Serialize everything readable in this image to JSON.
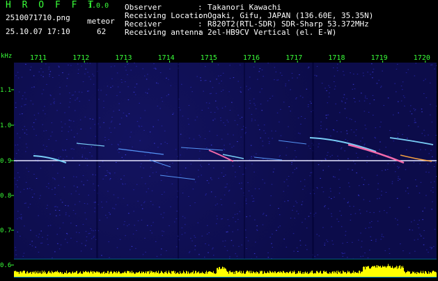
{
  "header": {
    "app_title": "H R O F F T",
    "app_version": "1.0.0",
    "file_name": "2510071710.png",
    "datetime": "25.10.07 17:10",
    "meteor_label": "meteor",
    "meteor_count": "62",
    "meta": [
      {
        "label": "Observer",
        "value": "Takanori Kawachi"
      },
      {
        "label": "Receiving Location",
        "value": "Ogaki, Gifu, JAPAN (136.60E, 35.35N)"
      },
      {
        "label": "Receiver",
        "value": "R820T2(RTL-SDR) SDR-Sharp 53.372MHz"
      },
      {
        "label": "Receiving antenna",
        "value": "2el-HB9CV Vertical (el. E-W)"
      }
    ]
  },
  "axes": {
    "y_unit": "kHz",
    "y_ticks": [
      "1.1",
      "1.0",
      "0.9",
      "0.8",
      "0.7",
      "0.6"
    ],
    "x_ticks": [
      "1711",
      "1712",
      "1713",
      "1714",
      "1715",
      "1716",
      "1717",
      "1718",
      "1719",
      "1720"
    ]
  },
  "colors": {
    "background": "#000000",
    "header_green": "#39ff39",
    "plot_bg": "#0c0c4a",
    "carrier_line": "#e6e6ff",
    "echo_cyan": "#7fd9ff",
    "echo_hot": "#ff6fb0",
    "histogram": "#ffff00",
    "baseline": "#00bfff"
  }
}
